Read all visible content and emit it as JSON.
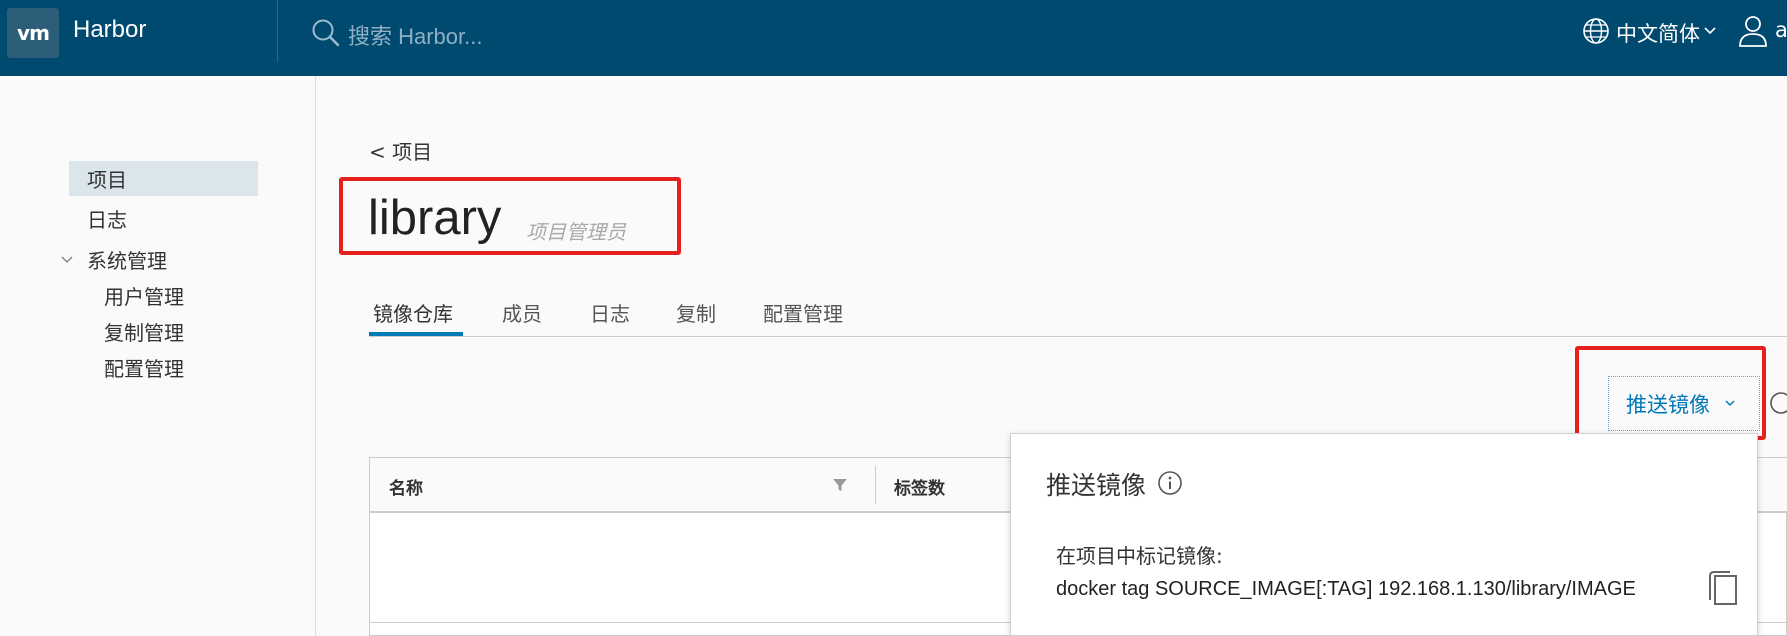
{
  "header": {
    "logo": "vm",
    "app_name": "Harbor",
    "search_placeholder": "搜索 Harbor...",
    "language": "中文简体",
    "user": "a"
  },
  "sidebar": {
    "items": [
      {
        "label": "项目",
        "active": true
      },
      {
        "label": "日志"
      },
      {
        "label": "系统管理",
        "expanded": true
      }
    ],
    "sub_items": [
      "用户管理",
      "复制管理",
      "配置管理"
    ]
  },
  "main": {
    "breadcrumb": "< 项目",
    "title": "library",
    "role": "项目管理员",
    "tabs": [
      "镜像仓库",
      "成员",
      "日志",
      "复制",
      "配置管理"
    ],
    "active_tab": "镜像仓库",
    "push_button": "推送镜像",
    "table_columns": [
      "名称",
      "标签数"
    ]
  },
  "push_panel": {
    "title": "推送镜像",
    "subtitle": "在项目中标记镜像:",
    "command": "docker tag SOURCE_IMAGE[:TAG] 192.168.1.130/library/IMAGE"
  },
  "colors": {
    "header_bg": "#004a70",
    "accent": "#0079b8",
    "highlight": "#e5211d",
    "active_nav_bg": "#dbe5ec"
  }
}
